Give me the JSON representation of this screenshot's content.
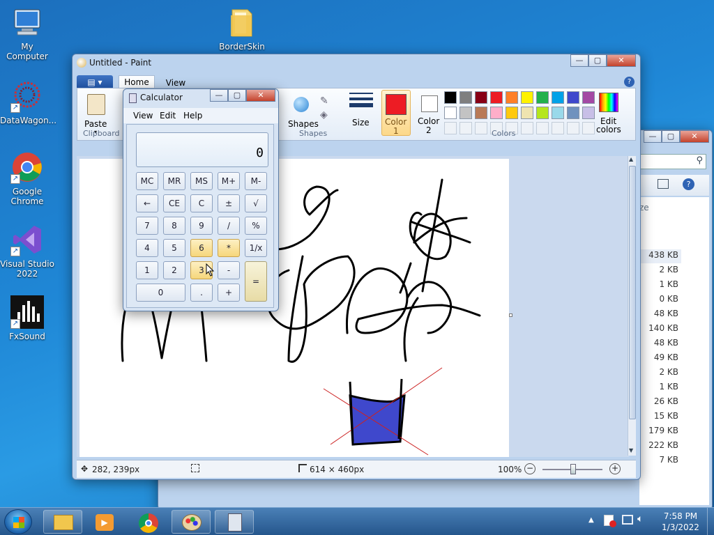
{
  "desktop": {
    "icons": [
      {
        "label": "My Computer"
      },
      {
        "label": "BorderSkin"
      },
      {
        "label": "DataWagon..."
      },
      {
        "label": "Google Chrome"
      },
      {
        "label": "Visual Studio 2022"
      },
      {
        "label": "FxSound"
      }
    ]
  },
  "paint": {
    "title": "Untitled - Paint",
    "tabs": [
      "Home",
      "View"
    ],
    "clipboard": {
      "paste_label": "Paste",
      "group_label": "Clipboard"
    },
    "shapes": {
      "shapes_label": "Shapes",
      "group_label": "Shapes",
      "size_label": "Size"
    },
    "colors": {
      "color1_label": "Color\n1",
      "color1_text": "Color",
      "color1_num": "1",
      "color2_text": "Color",
      "color2_num": "2",
      "color1_value": "#ed1c24",
      "color2_value": "#ffffff",
      "edit_colors_line1": "Edit",
      "edit_colors_line2": "colors",
      "group_label": "Colors",
      "palette_row1": [
        "#000000",
        "#7f7f7f",
        "#880015",
        "#ed1c24",
        "#ff7f27",
        "#fff200",
        "#22b14c",
        "#00a2e8",
        "#3f48cc",
        "#a349a4"
      ],
      "palette_row2": [
        "#ffffff",
        "#c3c3c3",
        "#b97a57",
        "#ffaec9",
        "#ffc90e",
        "#efe4b0",
        "#b5e61d",
        "#99d9ea",
        "#7092be",
        "#c8bfe7"
      ]
    },
    "status": {
      "cursor_pos": "282, 239px",
      "image_size": "614 × 460px",
      "zoom": "100%"
    }
  },
  "explorer": {
    "sizes": [
      "438 KB",
      "2 KB",
      "1 KB",
      "0 KB",
      "48 KB",
      "140 KB",
      "48 KB",
      "49 KB",
      "2 KB",
      "1 KB",
      "26 KB",
      "15 KB",
      "179 KB",
      "222 KB",
      "7 KB"
    ],
    "header_fragment": "ze"
  },
  "calculator": {
    "title": "Calculator",
    "menu": [
      "View",
      "Edit",
      "Help"
    ],
    "display": "0",
    "rows": [
      [
        "MC",
        "MR",
        "MS",
        "M+",
        "M-"
      ],
      [
        "←",
        "CE",
        "C",
        "±",
        "√"
      ],
      [
        "7",
        "8",
        "9",
        "/",
        "%"
      ],
      [
        "4",
        "5",
        "6",
        "*",
        "1/x"
      ],
      [
        "1",
        "2",
        "3",
        "-",
        "="
      ],
      [
        "0",
        ".",
        "+"
      ]
    ]
  },
  "taskbar": {
    "time": "7:58 PM",
    "date": "1/3/2022"
  }
}
